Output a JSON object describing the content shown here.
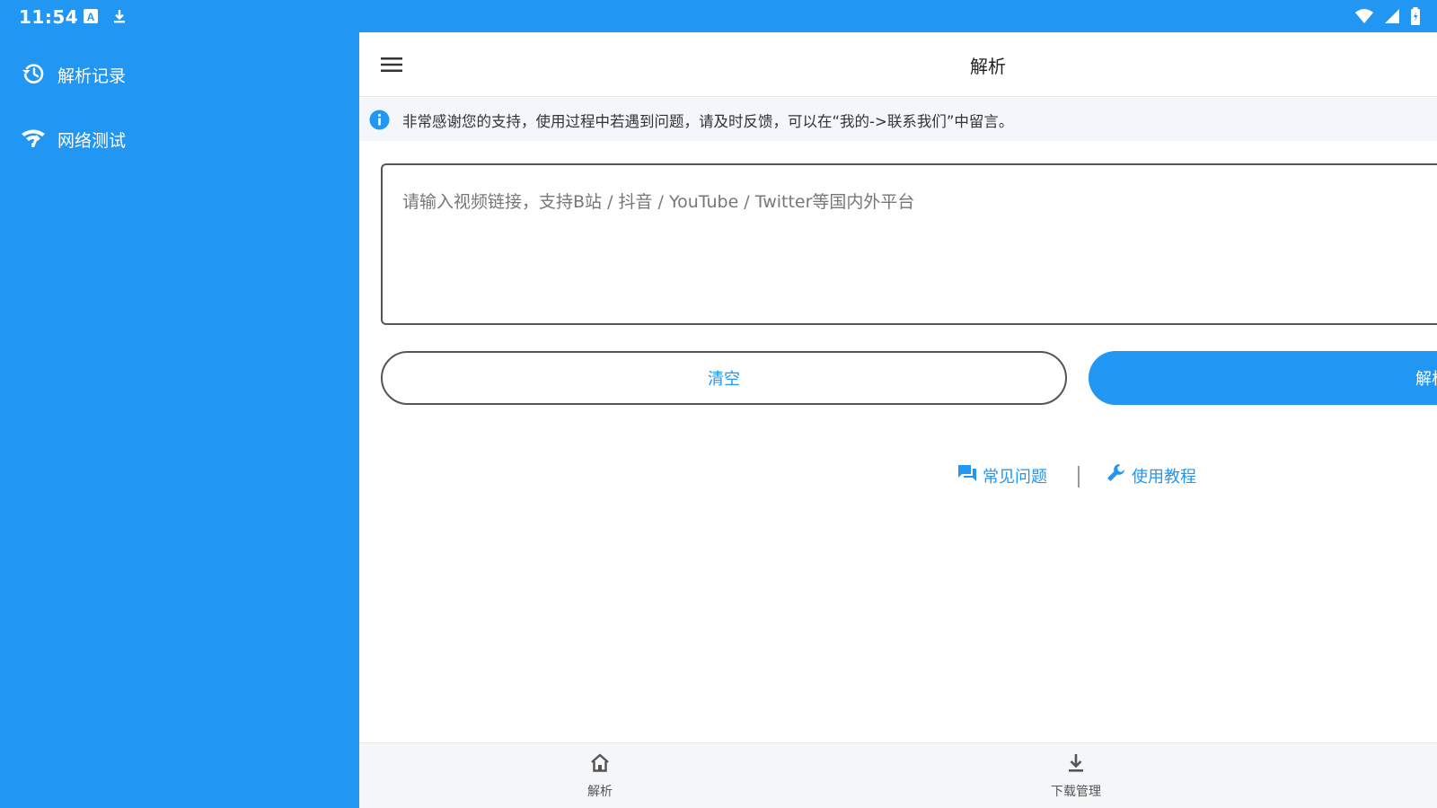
{
  "status_bar": {
    "time": "11:54",
    "left_icons": [
      "a-badge-icon",
      "download-notification-icon"
    ],
    "right_icons": [
      "wifi-icon",
      "cell-signal-icon",
      "battery-charging-icon"
    ]
  },
  "drawer": {
    "items": [
      {
        "label": "解析记录",
        "icon": "history-icon"
      },
      {
        "label": "网络测试",
        "icon": "network-test-icon"
      }
    ]
  },
  "toolbar": {
    "title": "解析",
    "menu_icon": "menu-icon"
  },
  "notice": {
    "icon": "info-icon",
    "text": "非常感谢您的支持，使用过程中若遇到问题，请及时反馈，可以在“我的->联系我们”中留言。"
  },
  "input": {
    "placeholder": "请输入视频链接，支持B站 / 抖音 / YouTube / Twitter等国内外平台",
    "value": ""
  },
  "buttons": {
    "clear": "清空",
    "parse": "解析"
  },
  "help": {
    "faq": {
      "label": "常见问题",
      "icon": "chat-icon"
    },
    "tutorial": {
      "label": "使用教程",
      "icon": "wrench-icon"
    }
  },
  "bottom_nav": {
    "items": [
      {
        "label": "解析",
        "icon": "home-icon"
      },
      {
        "label": "下载管理",
        "icon": "download-icon"
      }
    ]
  },
  "colors": {
    "primary": "#2196F3",
    "notice_bg": "#f3f7fc",
    "nav_bg": "#f5f6f8",
    "text": "#333333"
  }
}
